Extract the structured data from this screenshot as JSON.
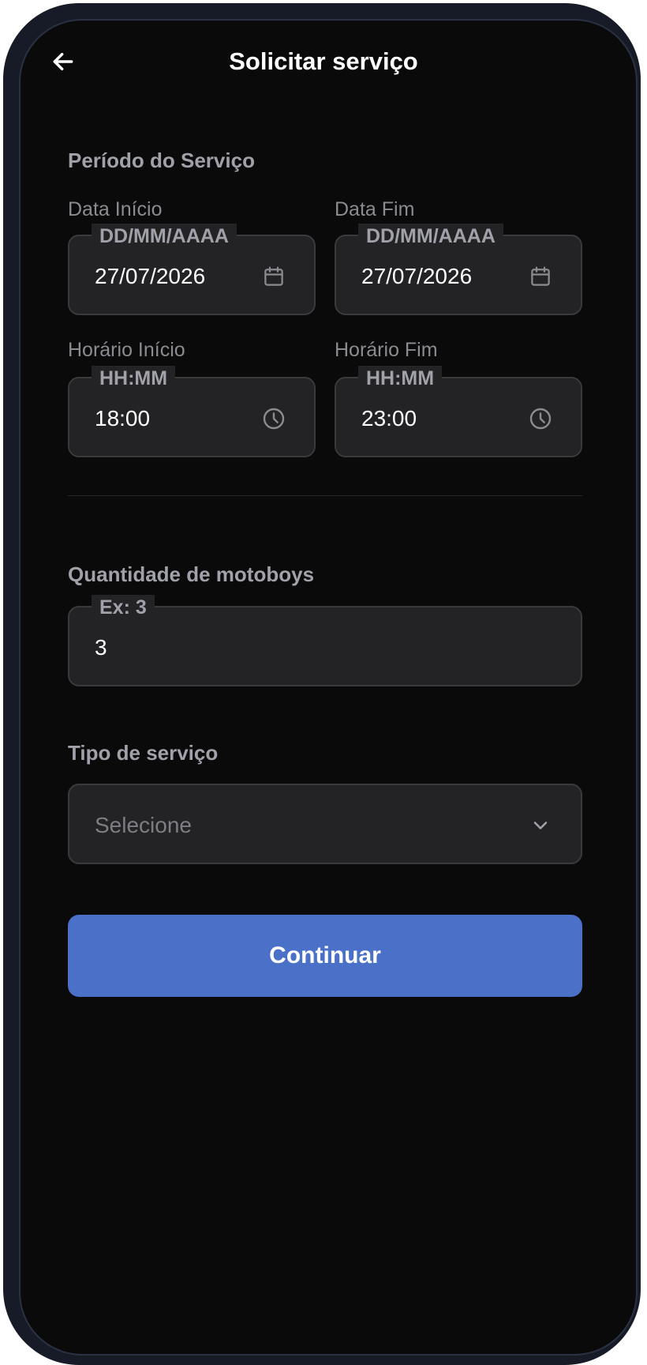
{
  "header": {
    "title": "Solicitar serviço"
  },
  "period": {
    "section_title": "Período do Serviço",
    "start_date": {
      "label": "Data Início",
      "placeholder": "DD/MM/AAAA",
      "value": "27/07/2026"
    },
    "end_date": {
      "label": "Data Fim",
      "placeholder": "DD/MM/AAAA",
      "value": "27/07/2026"
    },
    "start_time": {
      "label": "Horário Início",
      "placeholder": "HH:MM",
      "value": "18:00"
    },
    "end_time": {
      "label": "Horário Fim",
      "placeholder": "HH:MM",
      "value": "23:00"
    }
  },
  "quantity": {
    "section_title": "Quantidade de motoboys",
    "placeholder": "Ex: 3",
    "value": "3"
  },
  "service_type": {
    "section_title": "Tipo de serviço",
    "placeholder": "Selecione"
  },
  "actions": {
    "continue_label": "Continuar"
  },
  "colors": {
    "background": "#0a0a0b",
    "field_background": "#232325",
    "primary": "#4b70c8",
    "device_frame": "#161b27"
  },
  "icons": {
    "back": "arrow-left-icon",
    "date": "calendar-icon",
    "time": "clock-icon",
    "select": "chevron-down-icon"
  }
}
